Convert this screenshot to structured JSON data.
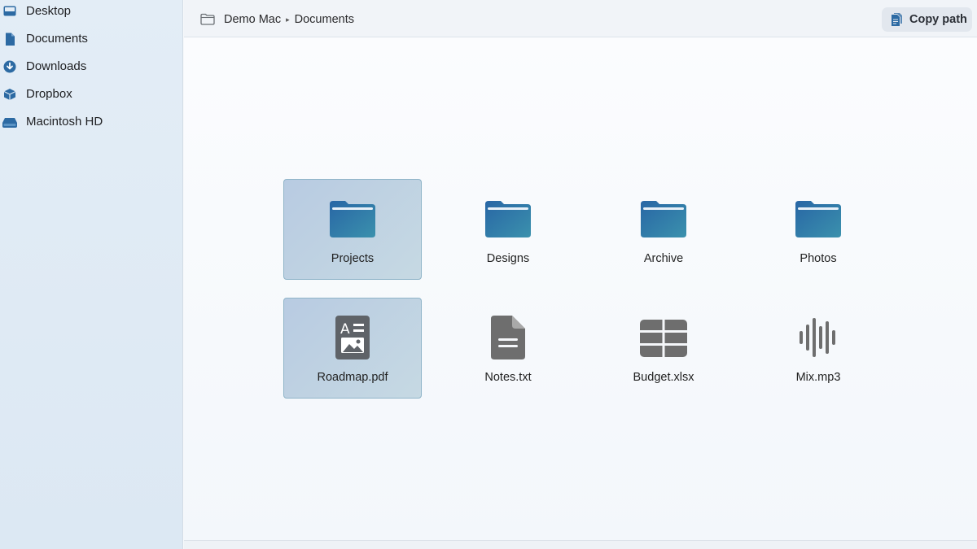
{
  "sidebar": {
    "items": [
      {
        "label": "Desktop",
        "icon": "desktop-icon"
      },
      {
        "label": "Documents",
        "icon": "document-icon"
      },
      {
        "label": "Downloads",
        "icon": "download-icon"
      },
      {
        "label": "Dropbox",
        "icon": "dropbox-icon"
      },
      {
        "label": "Macintosh HD",
        "icon": "hard-drive-icon"
      }
    ]
  },
  "toolbar": {
    "breadcrumb": {
      "root": "Demo Mac",
      "separator": "▸",
      "current": "Documents"
    },
    "copy_path_label": "Copy path"
  },
  "files": [
    {
      "name": "Projects",
      "type": "folder",
      "selected": true
    },
    {
      "name": "Designs",
      "type": "folder",
      "selected": false
    },
    {
      "name": "Archive",
      "type": "folder",
      "selected": false
    },
    {
      "name": "Photos",
      "type": "folder",
      "selected": false
    },
    {
      "name": "Roadmap.pdf",
      "type": "pdf",
      "selected": true
    },
    {
      "name": "Notes.txt",
      "type": "text",
      "selected": false
    },
    {
      "name": "Budget.xlsx",
      "type": "spreadsheet",
      "selected": false
    },
    {
      "name": "Mix.mp3",
      "type": "audio",
      "selected": false
    }
  ],
  "colors": {
    "accent": "#2a6fa8",
    "folder_top": "#2b6aa6",
    "folder_bottom": "#3a8fae",
    "file_icon_gray": "#6e6e6e",
    "selection_fill": "#b8cbe2"
  }
}
